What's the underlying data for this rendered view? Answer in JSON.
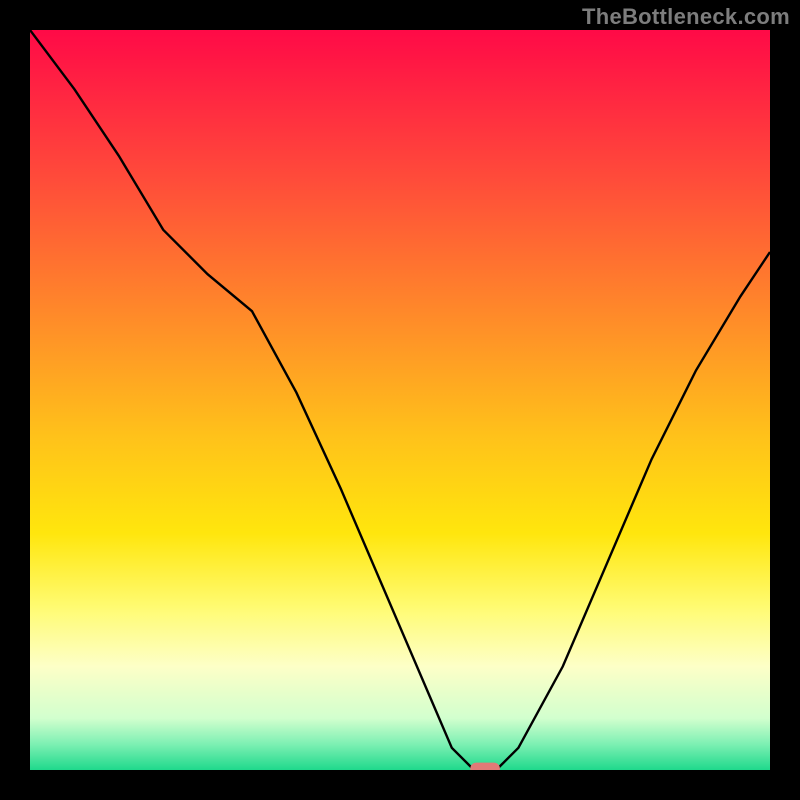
{
  "watermark": "TheBottleneck.com",
  "chart_data": {
    "type": "line",
    "title": "",
    "xlabel": "",
    "ylabel": "",
    "xlim": [
      0,
      100
    ],
    "ylim": [
      0,
      100
    ],
    "grid": false,
    "legend": false,
    "background": {
      "type": "vertical-gradient",
      "stops": [
        {
          "pos": 0.0,
          "color": "#ff0a47"
        },
        {
          "pos": 0.2,
          "color": "#ff4b3a"
        },
        {
          "pos": 0.4,
          "color": "#ff8f28"
        },
        {
          "pos": 0.55,
          "color": "#ffc21a"
        },
        {
          "pos": 0.68,
          "color": "#ffe60d"
        },
        {
          "pos": 0.78,
          "color": "#fffb72"
        },
        {
          "pos": 0.86,
          "color": "#fdffc7"
        },
        {
          "pos": 0.93,
          "color": "#d2ffce"
        },
        {
          "pos": 0.965,
          "color": "#7df0b3"
        },
        {
          "pos": 1.0,
          "color": "#1fd98c"
        }
      ]
    },
    "series": [
      {
        "name": "bottleneck-curve",
        "color": "#000000",
        "x": [
          0,
          6,
          12,
          18,
          24,
          30,
          36,
          42,
          48,
          54,
          57,
          60,
          63,
          66,
          72,
          78,
          84,
          90,
          96,
          100
        ],
        "y": [
          100,
          92,
          83,
          73,
          67,
          62,
          51,
          38,
          24,
          10,
          3,
          0,
          0,
          3,
          14,
          28,
          42,
          54,
          64,
          70
        ]
      }
    ],
    "marker": {
      "name": "optimal-point",
      "shape": "rounded-rect",
      "color": "#e17a77",
      "x": 61.5,
      "y": 0,
      "w": 4,
      "h": 2
    }
  }
}
